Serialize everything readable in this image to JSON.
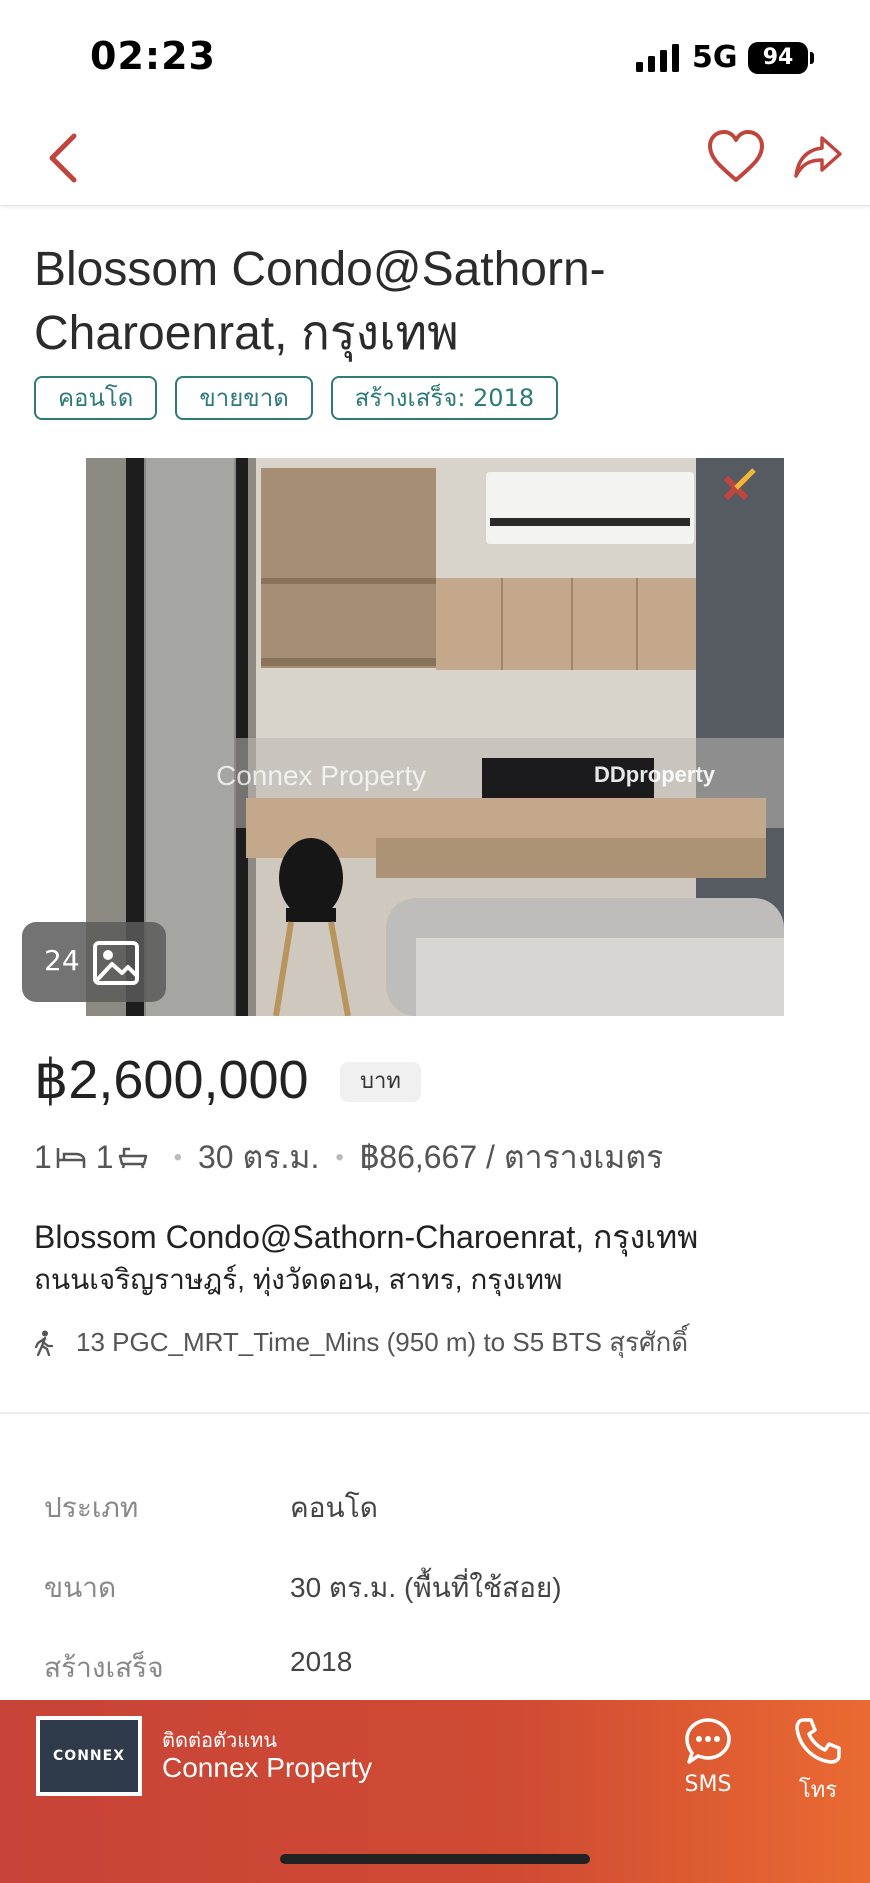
{
  "status_bar": {
    "time": "02:23",
    "network": "5G",
    "battery": "94"
  },
  "nav": {
    "back_icon": "chevron-left-icon",
    "favorite_icon": "heart-icon",
    "share_icon": "share-icon",
    "accent_color": "#c0463d"
  },
  "listing": {
    "title": "Blossom Condo@Sathorn-Charoenrat, กรุงเทพ",
    "tags": [
      "คอนโด",
      "ขายขาด",
      "สร้างเสร็จ: 2018"
    ],
    "photo": {
      "count": "24",
      "watermark_left": "Connex Property",
      "watermark_right": "DDproperty"
    },
    "price": "฿2,600,000",
    "currency": "บาท",
    "specs": {
      "bedrooms": "1",
      "bathrooms": "1",
      "area": "30 ตร.ม.",
      "price_per_sqm": "฿86,667 / ตารางเมตร"
    },
    "address_title": "Blossom Condo@Sathorn-Charoenrat, กรุงเทพ",
    "address_sub": "ถนนเจริญราษฎร์, ทุ่งวัดดอน, สาทร, กรุงเทพ",
    "transit": "13 PGC_MRT_Time_Mins (950 m) to S5 BTS สุรศักดิ์"
  },
  "details": [
    {
      "key": "ประเภท",
      "value": "คอนโด"
    },
    {
      "key": "ขนาด",
      "value": "30 ตร.ม. (พื้นที่ใช้สอย)"
    },
    {
      "key": "สร้างเสร็จ",
      "value": "2018"
    }
  ],
  "contact": {
    "label": "ติดต่อตัวแทน",
    "agent_name": "Connex Property",
    "logo_text": "CONNEX",
    "sms_label": "SMS",
    "call_label": "โทร"
  }
}
